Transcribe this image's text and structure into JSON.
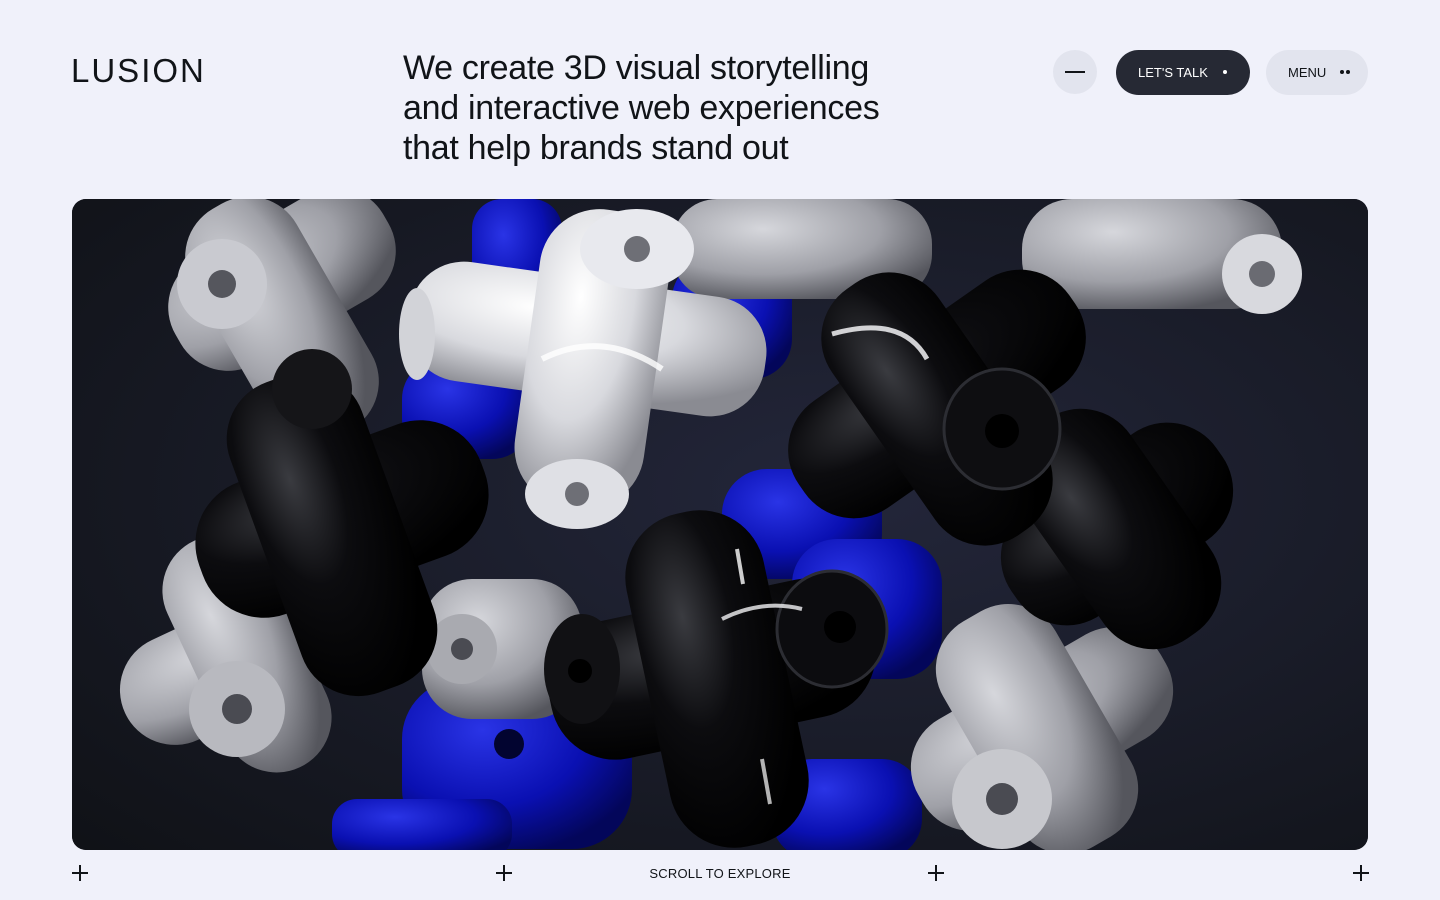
{
  "brand": {
    "logo_text": "LUSION"
  },
  "header": {
    "headline_lines": [
      "We create 3D visual storytelling",
      "and interactive web experiences",
      "that help brands stand out"
    ],
    "cta_label": "LET'S TALK",
    "menu_label": "MENU"
  },
  "footer": {
    "scroll_label": "SCROLL TO EXPLORE"
  },
  "colors": {
    "background": "#f0f1fa",
    "dark_button": "#262934",
    "light_button": "#e2e4ee",
    "hero_background": "#12141a",
    "accent_blue": "#0a0fb4"
  },
  "icons": {
    "collapse": "minus-icon",
    "cta": "dot-icon",
    "menu": "two-dots-icon",
    "corners": "plus-icon"
  }
}
